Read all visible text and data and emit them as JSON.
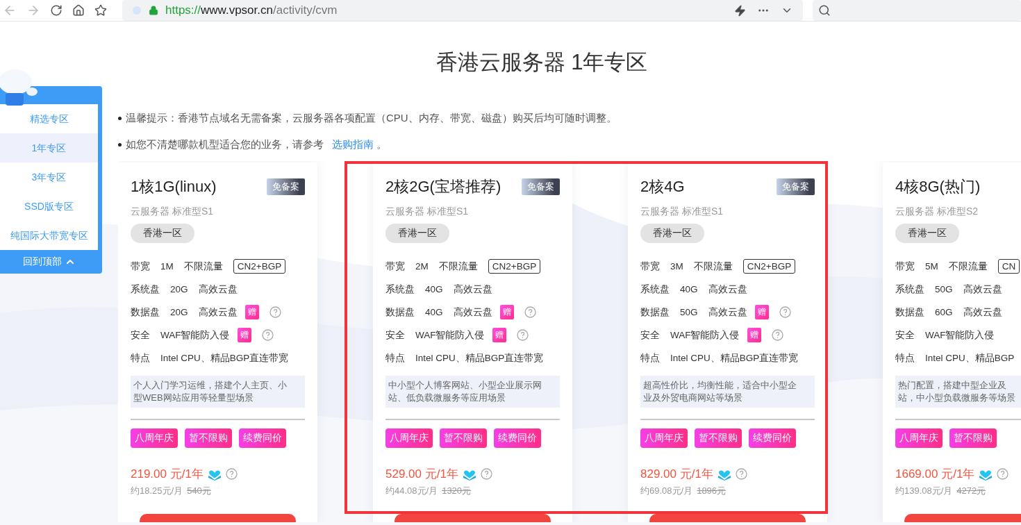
{
  "browser": {
    "url_scheme": "https://",
    "url_host": "www.vpsor.cn",
    "url_path": "/activity/cvm"
  },
  "sidebar": {
    "items": [
      {
        "label": "精选专区",
        "selected": false
      },
      {
        "label": "1年专区",
        "selected": true
      },
      {
        "label": "3年专区",
        "selected": false
      },
      {
        "label": "SSD版专区",
        "selected": false
      },
      {
        "label": "纯国际大带宽专区",
        "selected": false
      }
    ],
    "back_to_top": "回到顶部"
  },
  "page_title": "香港云服务器 1年专区",
  "notes": [
    {
      "text": "温馨提示：香港节点域名无需备案，云服务器各项配置（CPU、内存、带宽、磁盘）购买后均可随时调整。"
    },
    {
      "text": "如您不清楚哪款机型适合您的业务，请参考",
      "link": "选购指南",
      "link_suffix": "。"
    }
  ],
  "cards": [
    {
      "title": "1核1G(linux)",
      "badge": "免备案",
      "subtitle": "云服务器 标准型S1",
      "region": "香港一区",
      "highlighted": false,
      "specs": [
        {
          "cells": [
            "带宽",
            "1M",
            "不限流量"
          ],
          "tag": "CN2+BGP",
          "help": false
        },
        {
          "cells": [
            "系统盘",
            "20G",
            "高效云盘"
          ],
          "help": false
        },
        {
          "cells": [
            "数据盘",
            "20G",
            "高效云盘"
          ],
          "gift": "赠",
          "help": true
        },
        {
          "cells": [
            "安全",
            "WAF智能防入侵"
          ],
          "gift": "赠",
          "help": true
        },
        {
          "cells": [
            "特点",
            "Intel CPU、精品BGP直连带宽"
          ],
          "help": false
        }
      ],
      "desc": [
        "个人入门学习运维，搭建个人主页、小",
        "型WEB网站应用等轻量型场景"
      ],
      "tags": [
        "八周年庆",
        "暂不限购",
        "续费同价"
      ],
      "price": "219.00 元/1年",
      "monthly": "约18.25元/月",
      "original": "540元"
    },
    {
      "title": "2核2G(宝塔推荐)",
      "badge": "免备案",
      "subtitle": "云服务器 标准型S1",
      "region": "香港一区",
      "highlighted": true,
      "specs": [
        {
          "cells": [
            "带宽",
            "2M",
            "不限流量"
          ],
          "tag": "CN2+BGP",
          "help": false
        },
        {
          "cells": [
            "系统盘",
            "40G",
            "高效云盘"
          ],
          "help": false
        },
        {
          "cells": [
            "数据盘",
            "40G",
            "高效云盘"
          ],
          "gift": "赠",
          "help": true
        },
        {
          "cells": [
            "安全",
            "WAF智能防入侵"
          ],
          "gift": "赠",
          "help": true
        },
        {
          "cells": [
            "特点",
            "Intel CPU、精品BGP直连带宽"
          ],
          "help": false
        }
      ],
      "desc": [
        "中小型个人博客网站、小型企业展示网",
        "站、低负载微服务等应用场景"
      ],
      "tags": [
        "八周年庆",
        "暂不限购",
        "续费同价"
      ],
      "price": "529.00 元/1年",
      "monthly": "约44.08元/月",
      "original": "1320元"
    },
    {
      "title": "2核4G",
      "badge": "免备案",
      "subtitle": "云服务器 标准型S1",
      "region": "香港一区",
      "highlighted": true,
      "specs": [
        {
          "cells": [
            "带宽",
            "3M",
            "不限流量"
          ],
          "tag": "CN2+BGP",
          "help": false
        },
        {
          "cells": [
            "系统盘",
            "40G",
            "高效云盘"
          ],
          "help": false
        },
        {
          "cells": [
            "数据盘",
            "50G",
            "高效云盘"
          ],
          "gift": "赠",
          "help": true
        },
        {
          "cells": [
            "安全",
            "WAF智能防入侵"
          ],
          "gift": "赠",
          "help": true
        },
        {
          "cells": [
            "特点",
            "Intel CPU、精品BGP直连带宽"
          ],
          "help": false
        }
      ],
      "desc": [
        "超高性价比，均衡性能，适合中小型企",
        "业及外贸电商网站等场景"
      ],
      "tags": [
        "八周年庆",
        "暂不限购",
        "续费同价"
      ],
      "price": "829.00 元/1年",
      "monthly": "约69.08元/月",
      "original": "1896元"
    },
    {
      "title": "4核8G(热门)",
      "subtitle": "云服务器 标准型S2",
      "region": "香港一区",
      "highlighted": false,
      "specs": [
        {
          "cells": [
            "带宽",
            "5M",
            "不限流量"
          ],
          "tag": "CN",
          "help": false
        },
        {
          "cells": [
            "系统盘",
            "50G",
            "高效云盘"
          ],
          "help": false
        },
        {
          "cells": [
            "数据盘",
            "60G",
            "高效云盘"
          ],
          "help": false
        },
        {
          "cells": [
            "安全",
            "WAF智能防入侵"
          ],
          "help": false
        },
        {
          "cells": [
            "特点",
            "Intel CPU、精品BGP"
          ],
          "help": false
        }
      ],
      "desc": [
        "热门配置，搭建中型企业及",
        "站，中小型负载微服务等场景"
      ],
      "tags": [
        "八周年庆",
        "暂不限购"
      ],
      "price": "1669.00 元/1年",
      "monthly": "约139.08元/月",
      "original": "4272元"
    }
  ]
}
